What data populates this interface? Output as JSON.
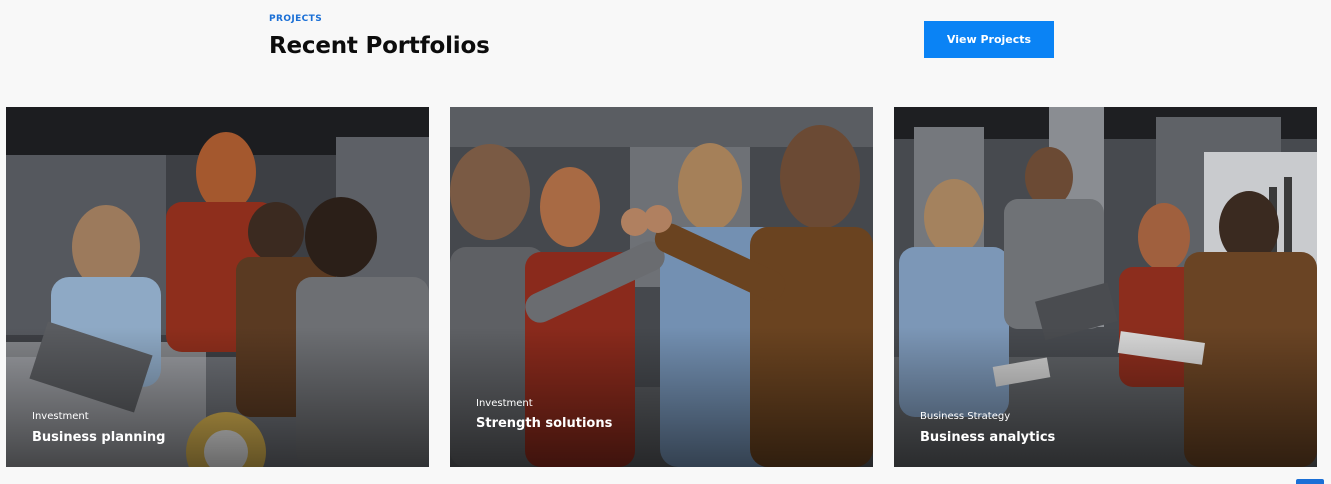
{
  "header": {
    "eyebrow": "PROJECTS",
    "title": "Recent Portfolios",
    "cta_label": "View Projects"
  },
  "portfolios": [
    {
      "category": "Investment",
      "title": "Business planning"
    },
    {
      "category": "Investment",
      "title": "Strength solutions"
    },
    {
      "category": "Business Strategy",
      "title": "Business analytics"
    }
  ],
  "colors": {
    "accent": "#0a83f5",
    "background": "#f8f8f8",
    "heading": "#0c0c0c"
  }
}
